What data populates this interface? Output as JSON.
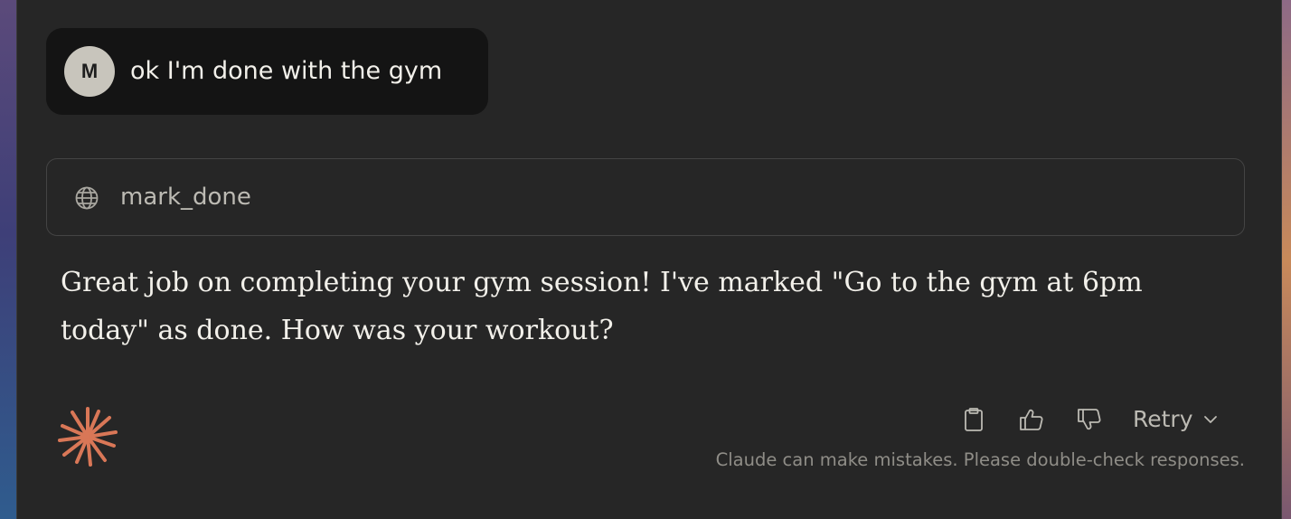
{
  "user_message": {
    "avatar_initial": "M",
    "text": "ok I'm done with the gym"
  },
  "tool_call": {
    "icon": "globe-icon",
    "name": "mark_done"
  },
  "assistant_message": {
    "text": "Great job on completing your gym session! I've marked \"Go to the gym at 6pm today\" as done. How was your workout?"
  },
  "actions": {
    "copy_icon": "clipboard-icon",
    "thumbs_up_icon": "thumbs-up-icon",
    "thumbs_down_icon": "thumbs-down-icon",
    "retry_label": "Retry",
    "retry_icon": "chevron-down-icon"
  },
  "disclaimer": "Claude can make mistakes. Please double-check responses.",
  "colors": {
    "background": "#262626",
    "user_bubble": "#141414",
    "avatar": "#c8c5bc",
    "accent": "#d97757",
    "text_primary": "#f2f0ea",
    "text_muted": "#8f8d87"
  }
}
